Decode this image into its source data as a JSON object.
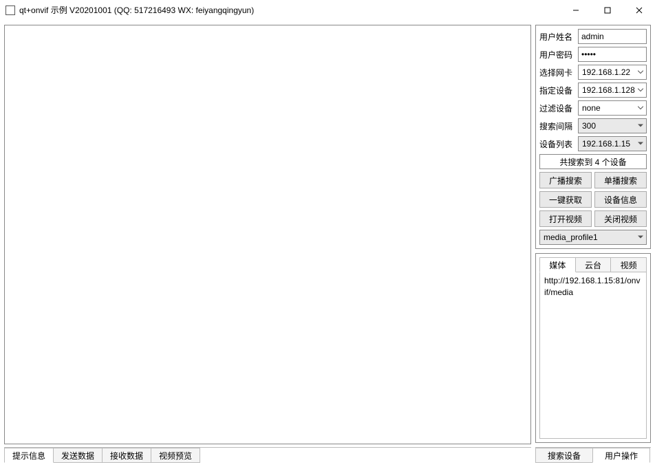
{
  "window": {
    "title": "qt+onvif 示例 V20201001 (QQ: 517216493 WX: feiyangqingyun)"
  },
  "form": {
    "username_label": "用户姓名",
    "username_value": "admin",
    "password_label": "用户密码",
    "password_value": "•••••",
    "nic_label": "选择网卡",
    "nic_value": "192.168.1.22",
    "device_label": "指定设备",
    "device_value": "192.168.1.128",
    "filter_label": "过滤设备",
    "filter_value": "none",
    "interval_label": "搜索间隔",
    "interval_value": "300",
    "devlist_label": "设备列表",
    "devlist_value": "192.168.1.15"
  },
  "status_text": "共搜索到 4 个设备",
  "buttons": {
    "broadcast_search": "广播搜索",
    "unicast_search": "单播搜索",
    "one_click_fetch": "一键获取",
    "device_info": "设备信息",
    "open_video": "打开视频",
    "close_video": "关闭视频"
  },
  "profile_value": "media_profile1",
  "info_tabs": {
    "t1": "媒体",
    "t2": "云台",
    "t3": "视频"
  },
  "info_content": "http://192.168.1.15:81/onvif/media",
  "left_tabs": {
    "t1": "提示信息",
    "t2": "发送数据",
    "t3": "接收数据",
    "t4": "视频预览"
  },
  "right_footer_tabs": {
    "t1": "搜索设备",
    "t2": "用户操作"
  }
}
